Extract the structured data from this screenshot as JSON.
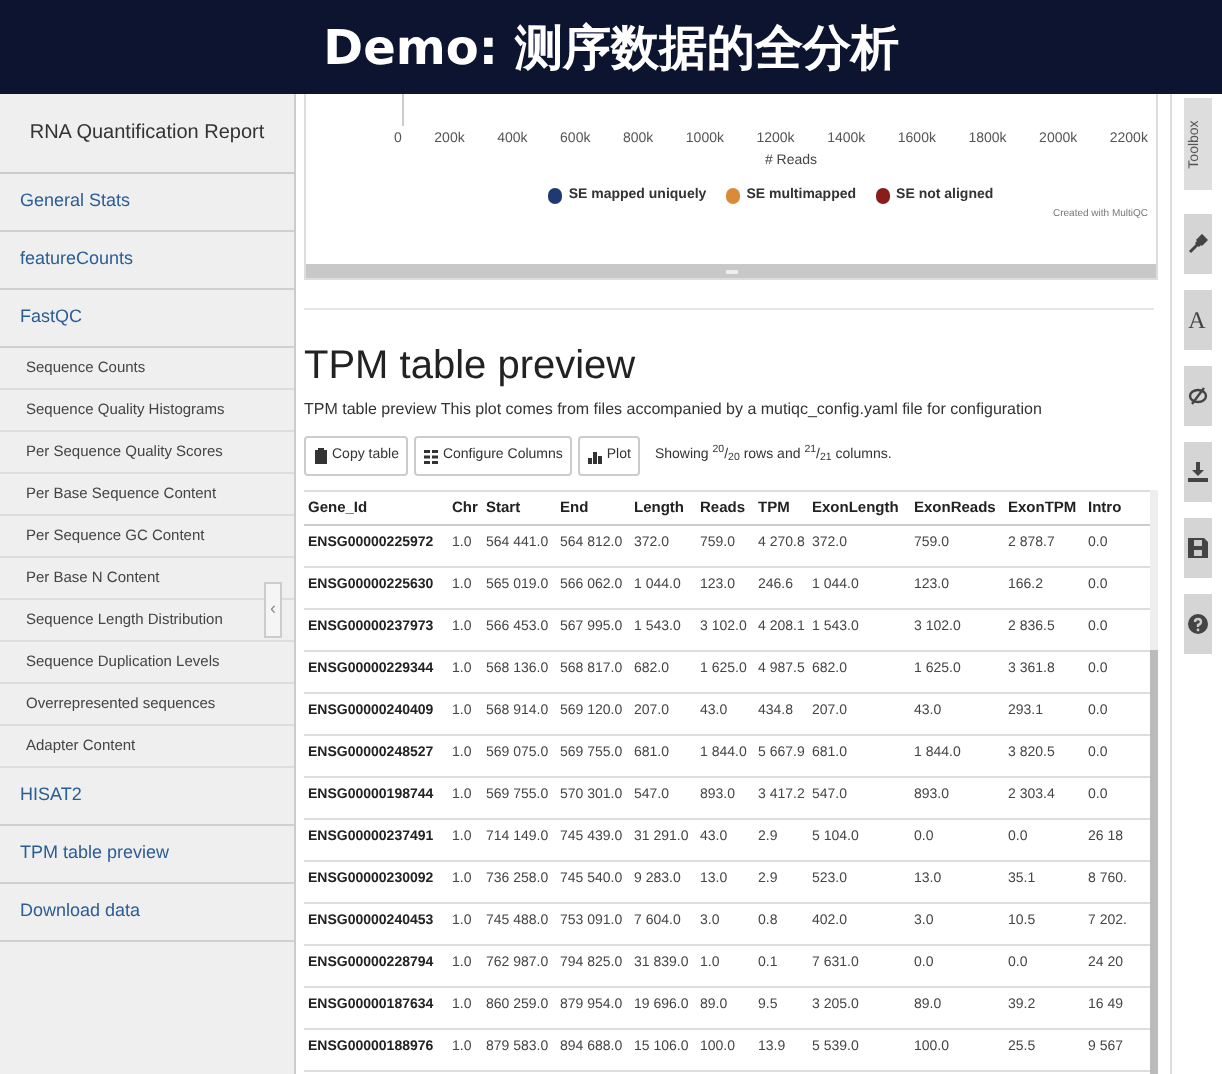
{
  "banner": {
    "title": "Demo: 测序数据的全分析"
  },
  "sidebar": {
    "title": "RNA Quantification Report",
    "items": [
      {
        "kind": "section",
        "label": "General Stats"
      },
      {
        "kind": "section",
        "label": "featureCounts"
      },
      {
        "kind": "section",
        "label": "FastQC"
      },
      {
        "kind": "subsection",
        "label": "Sequence Counts"
      },
      {
        "kind": "subsection",
        "label": "Sequence Quality Histograms"
      },
      {
        "kind": "subsection",
        "label": "Per Sequence Quality Scores"
      },
      {
        "kind": "subsection",
        "label": "Per Base Sequence Content"
      },
      {
        "kind": "subsection",
        "label": "Per Sequence GC Content"
      },
      {
        "kind": "subsection",
        "label": "Per Base N Content"
      },
      {
        "kind": "subsection",
        "label": "Sequence Length Distribution"
      },
      {
        "kind": "subsection",
        "label": "Sequence Duplication Levels"
      },
      {
        "kind": "subsection",
        "label": "Overrepresented sequences"
      },
      {
        "kind": "subsection",
        "label": "Adapter Content"
      },
      {
        "kind": "section",
        "label": "HISAT2"
      },
      {
        "kind": "section",
        "label": "TPM table preview"
      },
      {
        "kind": "section",
        "label": "Download data"
      }
    ],
    "toggle": "‹"
  },
  "plot": {
    "x_ticks": [
      "0",
      "200k",
      "400k",
      "600k",
      "800k",
      "1000k",
      "1200k",
      "1400k",
      "1600k",
      "1800k",
      "2000k",
      "2200k"
    ],
    "xlabel": "# Reads",
    "legend": [
      {
        "label": "SE mapped uniquely",
        "color": "#1f3a73"
      },
      {
        "label": "SE multimapped",
        "color": "#d98b3a"
      },
      {
        "label": "SE not aligned",
        "color": "#8a1c1c"
      }
    ],
    "credit": "Created with MultiQC"
  },
  "section": {
    "title": "TPM table preview",
    "description": "TPM table preview This plot comes from files accompanied by a mutiqc_config.yaml file for configuration",
    "buttons": [
      {
        "kind": "copy",
        "label": "Copy table"
      },
      {
        "kind": "columns",
        "label": "Configure Columns"
      },
      {
        "kind": "plot",
        "label": "Plot"
      }
    ],
    "summary": "Showing $^{20}$/$_{20}$ rows and $^{21}$/$_{21}$ columns."
  },
  "table": {
    "columns": [
      "Gene_Id",
      "Chr",
      "Start",
      "End",
      "Length",
      "Reads",
      "TPM",
      "ExonLength",
      "ExonReads",
      "ExonTPM",
      "Intro"
    ],
    "rows": [
      [
        "ENSG00000225972",
        "1.0",
        "564 441.0",
        "564 812.0",
        "372.0",
        "759.0",
        "4 270.8",
        "372.0",
        "759.0",
        "2 878.7",
        "0.0"
      ],
      [
        "ENSG00000225630",
        "1.0",
        "565 019.0",
        "566 062.0",
        "1 044.0",
        "123.0",
        "246.6",
        "1 044.0",
        "123.0",
        "166.2",
        "0.0"
      ],
      [
        "ENSG00000237973",
        "1.0",
        "566 453.0",
        "567 995.0",
        "1 543.0",
        "3 102.0",
        "4 208.1",
        "1 543.0",
        "3 102.0",
        "2 836.5",
        "0.0"
      ],
      [
        "ENSG00000229344",
        "1.0",
        "568 136.0",
        "568 817.0",
        "682.0",
        "1 625.0",
        "4 987.5",
        "682.0",
        "1 625.0",
        "3 361.8",
        "0.0"
      ],
      [
        "ENSG00000240409",
        "1.0",
        "568 914.0",
        "569 120.0",
        "207.0",
        "43.0",
        "434.8",
        "207.0",
        "43.0",
        "293.1",
        "0.0"
      ],
      [
        "ENSG00000248527",
        "1.0",
        "569 075.0",
        "569 755.0",
        "681.0",
        "1 844.0",
        "5 667.9",
        "681.0",
        "1 844.0",
        "3 820.5",
        "0.0"
      ],
      [
        "ENSG00000198744",
        "1.0",
        "569 755.0",
        "570 301.0",
        "547.0",
        "893.0",
        "3 417.2",
        "547.0",
        "893.0",
        "2 303.4",
        "0.0"
      ],
      [
        "ENSG00000237491",
        "1.0",
        "714 149.0",
        "745 439.0",
        "31 291.0",
        "43.0",
        "2.9",
        "5 104.0",
        "0.0",
        "0.0",
        "26 18"
      ],
      [
        "ENSG00000230092",
        "1.0",
        "736 258.0",
        "745 540.0",
        "9 283.0",
        "13.0",
        "2.9",
        "523.0",
        "13.0",
        "35.1",
        "8 760."
      ],
      [
        "ENSG00000240453",
        "1.0",
        "745 488.0",
        "753 091.0",
        "7 604.0",
        "3.0",
        "0.8",
        "402.0",
        "3.0",
        "10.5",
        "7 202."
      ],
      [
        "ENSG00000228794",
        "1.0",
        "762 987.0",
        "794 825.0",
        "31 839.0",
        "1.0",
        "0.1",
        "7 631.0",
        "0.0",
        "0.0",
        "24 20"
      ],
      [
        "ENSG00000187634",
        "1.0",
        "860 259.0",
        "879 954.0",
        "19 696.0",
        "89.0",
        "9.5",
        "3 205.0",
        "89.0",
        "39.2",
        "16 49"
      ],
      [
        "ENSG00000188976",
        "1.0",
        "879 583.0",
        "894 688.0",
        "15 106.0",
        "100.0",
        "13.9",
        "5 539.0",
        "100.0",
        "25.5",
        "9 567"
      ]
    ]
  },
  "toolbox": {
    "label": "Toolbox",
    "tools": [
      {
        "kind": "pin"
      },
      {
        "kind": "text",
        "glyph": "A"
      },
      {
        "kind": "hide"
      },
      {
        "kind": "download"
      },
      {
        "kind": "save"
      },
      {
        "kind": "help"
      }
    ]
  }
}
